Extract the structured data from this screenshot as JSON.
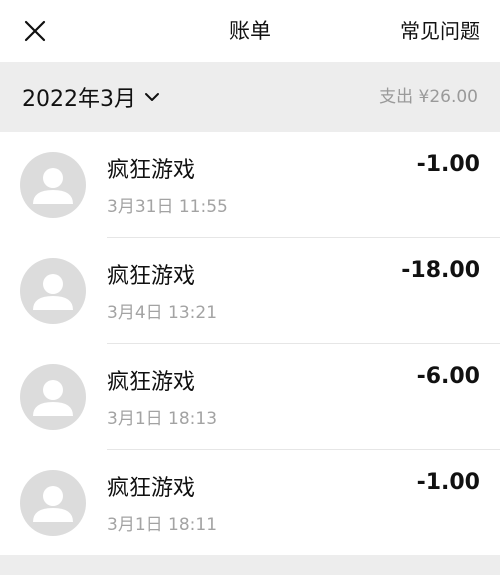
{
  "navbar": {
    "close_icon": "close-icon",
    "title": "账单",
    "faq_label": "常见问题"
  },
  "month_bar": {
    "month_label": "2022年3月",
    "dropdown_icon": "chevron-down-icon",
    "total_label": "支出 ¥26.00"
  },
  "transactions": [
    {
      "title": "疯狂游戏",
      "time": "3月31日 11:55",
      "amount": "-1.00",
      "avatar_icon": "default-avatar-icon"
    },
    {
      "title": "疯狂游戏",
      "time": "3月4日 13:21",
      "amount": "-18.00",
      "avatar_icon": "default-avatar-icon"
    },
    {
      "title": "疯狂游戏",
      "time": "3月1日 18:13",
      "amount": "-6.00",
      "avatar_icon": "default-avatar-icon"
    },
    {
      "title": "疯狂游戏",
      "time": "3月1日 18:11",
      "amount": "-1.00",
      "avatar_icon": "default-avatar-icon"
    }
  ],
  "colors": {
    "page_background": "#ededed",
    "card_background": "#ffffff",
    "primary_text": "#111111",
    "secondary_text": "#a3a3a3",
    "avatar_background": "#dcdcdc"
  }
}
